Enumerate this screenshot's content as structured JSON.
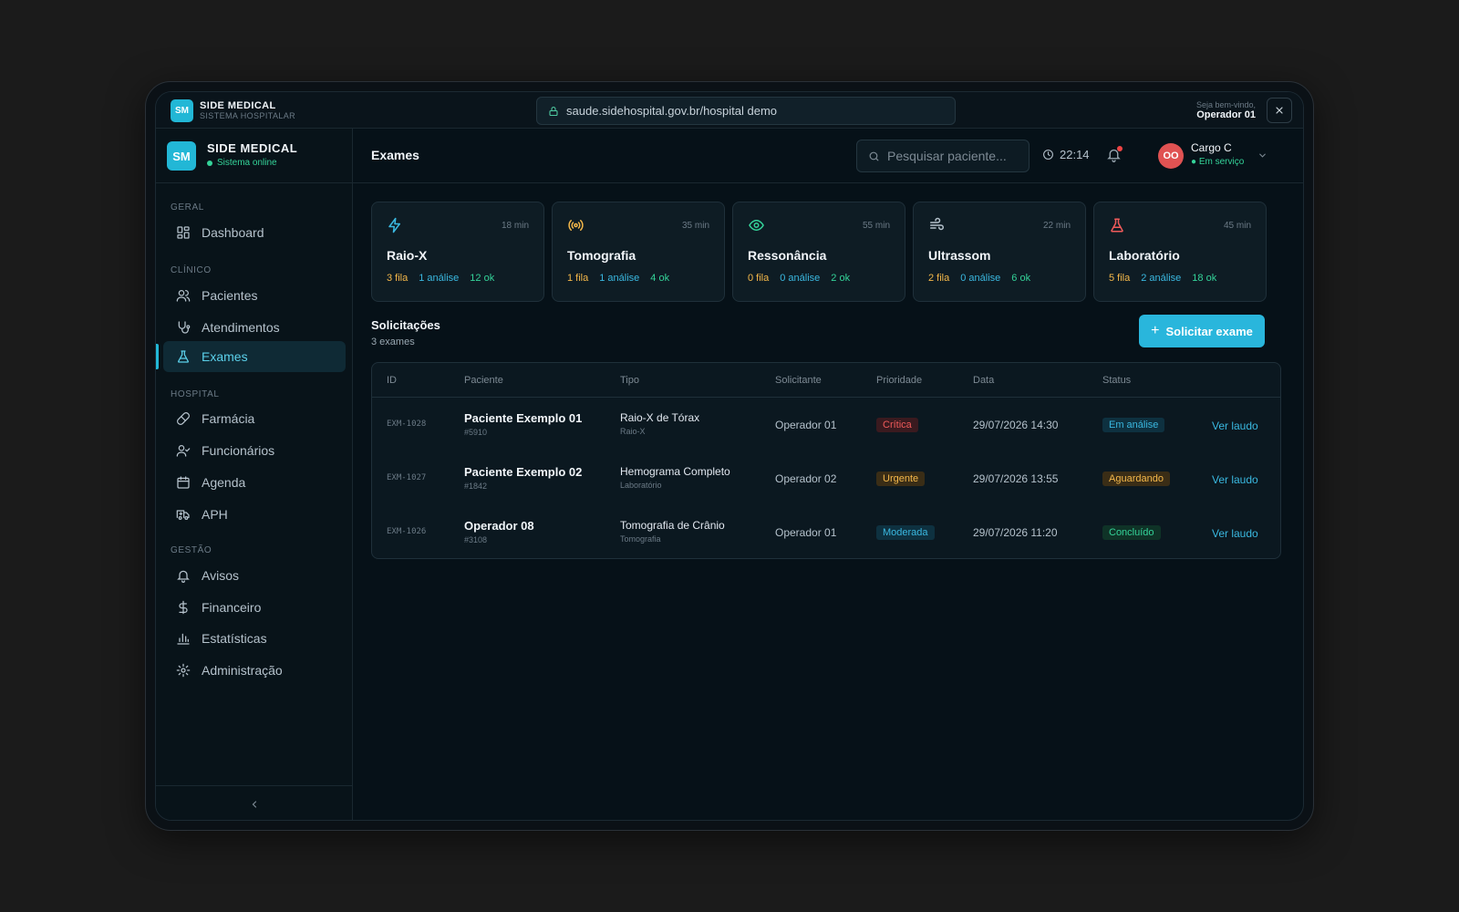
{
  "topbar": {
    "logo": "SM",
    "brand_title": "SIDE MEDICAL",
    "brand_sub": "SISTEMA HOSPITALAR",
    "url": "saude.sidehospital.gov.br/hospital demo",
    "welcome": "Seja bem-vindo,",
    "operator": "Operador 01"
  },
  "sidebar": {
    "logo": "SM",
    "title": "SIDE MEDICAL",
    "status": "Sistema online",
    "sections": {
      "geral": "GERAL",
      "clinico": "CLÍNICO",
      "hospital": "HOSPITAL",
      "gestao": "GESTÃO"
    },
    "items": {
      "dashboard": "Dashboard",
      "pacientes": "Pacientes",
      "atendimentos": "Atendimentos",
      "exames": "Exames",
      "farmacia": "Farmácia",
      "funcionarios": "Funcionários",
      "agenda": "Agenda",
      "aph": "APH",
      "avisos": "Avisos",
      "financeiro": "Financeiro",
      "estatisticas": "Estatísticas",
      "administracao": "Administração"
    }
  },
  "header": {
    "title": "Exames",
    "search_placeholder": "Pesquisar paciente...",
    "time": "22:14",
    "avatar": "OO",
    "user_role": "Cargo C",
    "user_status": "● Em serviço"
  },
  "cards": [
    {
      "name": "Raio-X",
      "time": "18 min",
      "fila": "3 fila",
      "analise": "1 análise",
      "ok": "12 ok",
      "icon": "lightning-icon",
      "color": "#3ab8e0"
    },
    {
      "name": "Tomografia",
      "time": "35 min",
      "fila": "1 fila",
      "analise": "1 análise",
      "ok": "4 ok",
      "icon": "radio-waves-icon",
      "color": "#f5b84a"
    },
    {
      "name": "Ressonância",
      "time": "55 min",
      "fila": "0 fila",
      "analise": "0 análise",
      "ok": "2 ok",
      "icon": "eye-icon",
      "color": "#34d399"
    },
    {
      "name": "Ultrassom",
      "time": "22 min",
      "fila": "2 fila",
      "analise": "0 análise",
      "ok": "6 ok",
      "icon": "wind-icon",
      "color": "#b5c2cc"
    },
    {
      "name": "Laboratório",
      "time": "45 min",
      "fila": "5 fila",
      "analise": "2 análise",
      "ok": "18 ok",
      "icon": "flask-icon",
      "color": "#ef5a5a"
    }
  ],
  "requests": {
    "title": "Solicitações",
    "count": "3 exames",
    "new_button": "Solicitar exame",
    "columns": [
      "ID",
      "Paciente",
      "Tipo",
      "Solicitante",
      "Prioridade",
      "Data",
      "Status"
    ],
    "rows": [
      {
        "id": "EXM-1028",
        "patient": "Paciente Exemplo 01",
        "patient_num": "#5910",
        "type": "Raio-X de Tórax",
        "type_sub": "Raio-X",
        "requester": "Operador 01",
        "priority": "Crítica",
        "date": "29/07/2026 14:30",
        "status": "Em análise",
        "action": "Ver laudo"
      },
      {
        "id": "EXM-1027",
        "patient": "Paciente Exemplo 02",
        "patient_num": "#1842",
        "type": "Hemograma Completo",
        "type_sub": "Laboratório",
        "requester": "Operador 02",
        "priority": "Urgente",
        "date": "29/07/2026 13:55",
        "status": "Aguardando",
        "action": "Ver laudo"
      },
      {
        "id": "EXM-1026",
        "patient": "Operador 08",
        "patient_num": "#3108",
        "type": "Tomografia de Crânio",
        "type_sub": "Tomografia",
        "requester": "Operador 01",
        "priority": "Moderada",
        "date": "29/07/2026 11:20",
        "status": "Concluído",
        "action": "Ver laudo"
      }
    ]
  },
  "colors": {
    "accent": "#22b7d6",
    "critica": "#ef5a5a",
    "urgente": "#f5b84a",
    "moderada": "#3ab8e0",
    "em_analise": "#3ab8e0",
    "aguardando": "#f5b84a",
    "concluido": "#34d399"
  }
}
